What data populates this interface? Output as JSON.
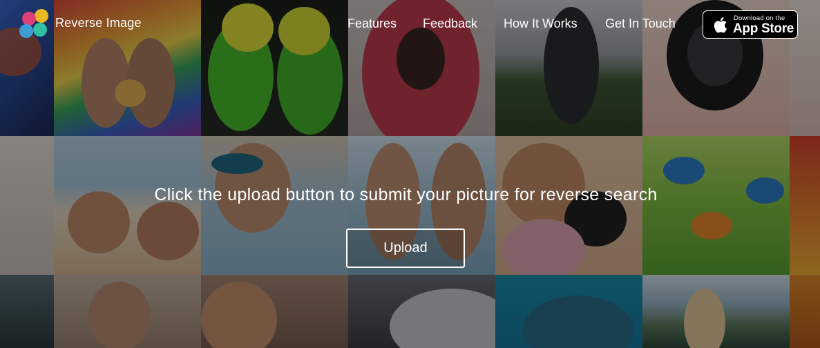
{
  "brand": {
    "name": "Reverse Image"
  },
  "nav": [
    {
      "label": "Features"
    },
    {
      "label": "Feedback"
    },
    {
      "label": "How It Works"
    },
    {
      "label": "Get In Touch"
    }
  ],
  "app_store": {
    "small_text": "Download on the",
    "big_text": "App Store",
    "icon": "apple-icon"
  },
  "hero": {
    "headline": "Click the upload button to submit your picture for reverse search",
    "upload_label": "Upload"
  },
  "colors": {
    "logo_dots": [
      "#f5c022",
      "#e8407a",
      "#3fa3dc",
      "#35c7a5"
    ],
    "overlay": "#000000"
  }
}
